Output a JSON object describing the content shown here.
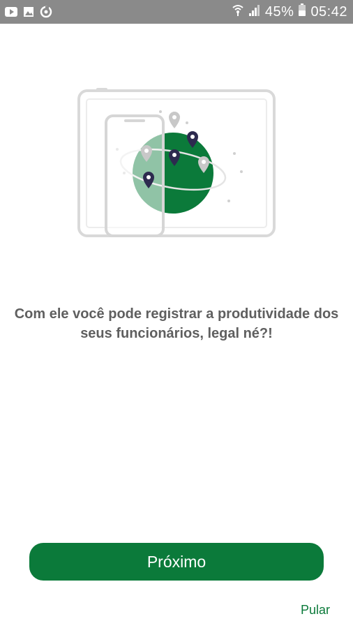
{
  "status_bar": {
    "battery": "45%",
    "time": "05:42",
    "icons": [
      "youtube-icon",
      "image-icon",
      "sync-icon",
      "wifi-icon",
      "signal-icon",
      "battery-icon"
    ]
  },
  "onboarding": {
    "message": "Com ele você pode registrar a produtividade dos seus funcionários, legal né?!",
    "next_label": "Próximo",
    "skip_label": "Pular"
  },
  "colors": {
    "status_bar_bg": "#8a8a8a",
    "accent_green": "#0b7a3a",
    "text_gray": "#5f5f5f",
    "pin_dark": "#2d2a4f",
    "pin_light": "#c8c8c8"
  }
}
